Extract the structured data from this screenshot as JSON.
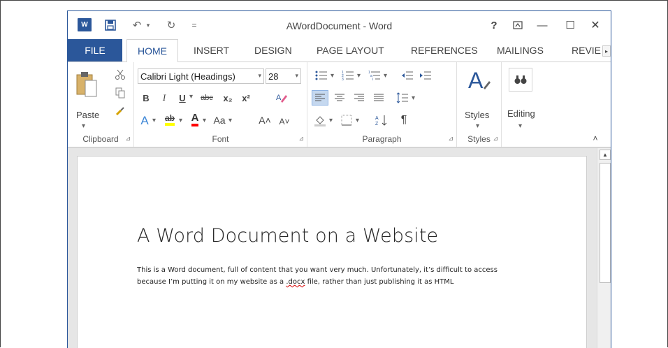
{
  "titlebar": {
    "title": "AWordDocument - Word",
    "word_icon": "W",
    "save_icon": "💾",
    "undo_icon": "↶",
    "undo_drop": "▾",
    "redo_icon": "↻",
    "customize_icon": "=",
    "help": "?",
    "ribbon_display": "⊼",
    "minimize": "—",
    "maximize": "☐",
    "close": "✕"
  },
  "tabs": {
    "file": "FILE",
    "items": [
      "HOME",
      "INSERT",
      "DESIGN",
      "PAGE LAYOUT",
      "REFERENCES",
      "MAILINGS",
      "REVIE"
    ],
    "active": "HOME",
    "scroll_right": "▸"
  },
  "ribbon": {
    "clipboard": {
      "label": "Clipboard",
      "paste_label": "Paste",
      "paste_drop": "▾"
    },
    "font": {
      "label": "Font",
      "font_name": "Calibri Light (Headings)",
      "font_size": "28",
      "bold": "B",
      "italic": "I",
      "underline": "U",
      "strikethrough": "abc",
      "subscript": "x₂",
      "superscript": "x²",
      "text_effects": "A",
      "highlight": "ab",
      "font_color": "A",
      "change_case": "Aa",
      "grow_font": "A˄",
      "shrink_font": "A˅"
    },
    "paragraph": {
      "label": "Paragraph",
      "bullets": "☰",
      "numbering": "☰",
      "multilevel": "☰",
      "decrease_indent": "⇤",
      "increase_indent": "⇥",
      "align_left": "☰",
      "align_center": "☰",
      "align_right": "☰",
      "justify": "☰",
      "line_spacing": "↕☰",
      "shading": "◇",
      "borders": "⊞",
      "sort": "A↓",
      "show_marks": "¶"
    },
    "styles": {
      "label": "Styles",
      "button_label": "Styles"
    },
    "editing": {
      "button_label": "Editing"
    },
    "collapse": "˄"
  },
  "document": {
    "heading": "A Word Document on a Website",
    "line1": "This is a Word document, full of content that you want very much. Unfortunately, it’s difficult to access",
    "line2_pre": "because I’m putting it on my website as a ",
    "line2_marked": ".docx",
    "line2_post": " file, rather than just publishing it as HTML"
  },
  "scrollbar": {
    "up": "▲"
  },
  "colors": {
    "accent": "#2b579a",
    "highlight_yellow": "#ffff00",
    "font_red": "#ff0000",
    "spell_red": "#d60000"
  }
}
